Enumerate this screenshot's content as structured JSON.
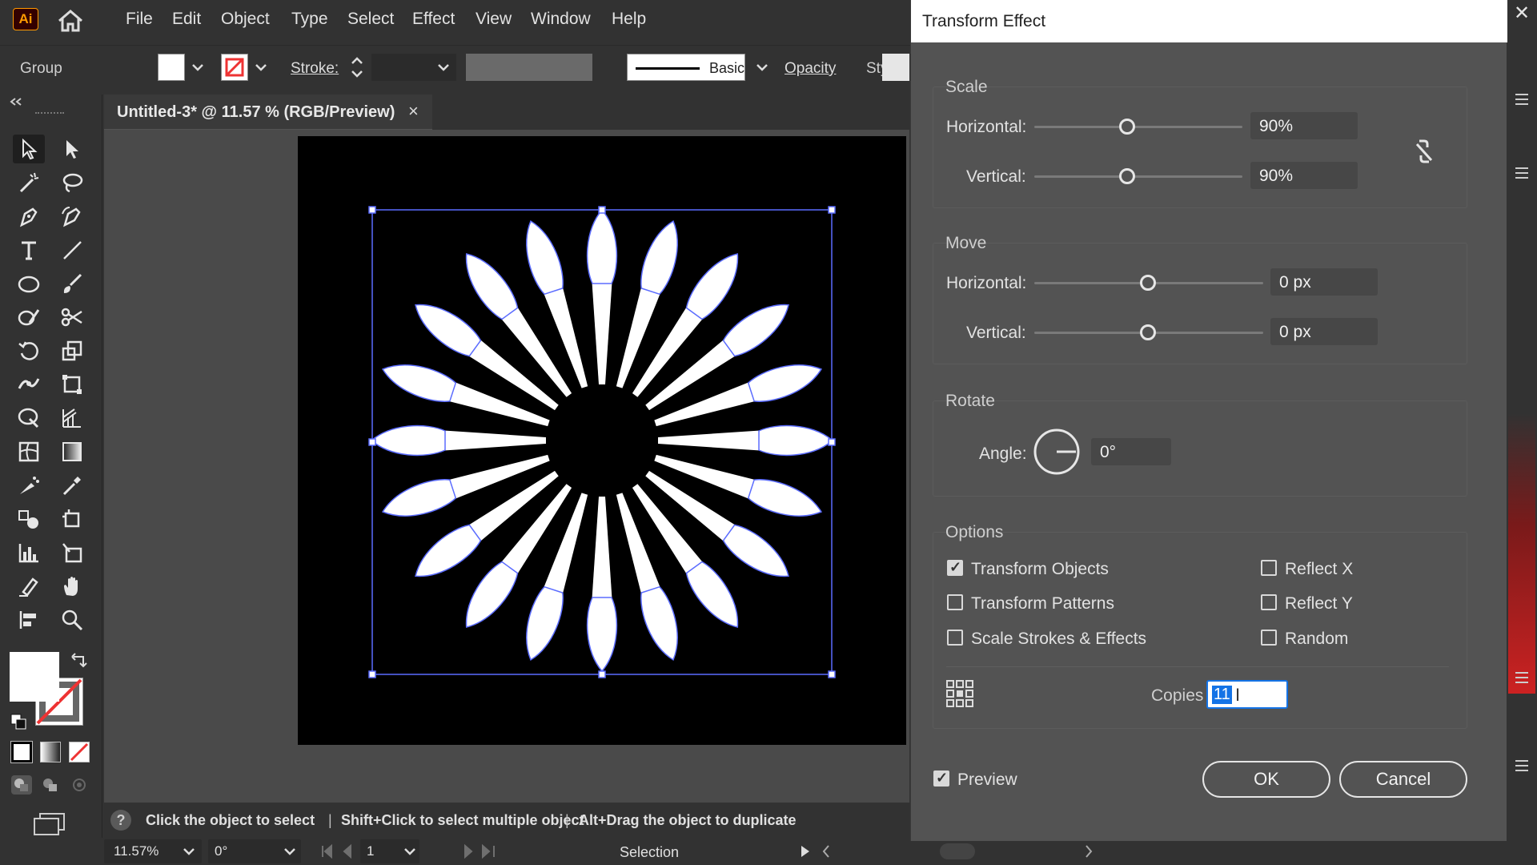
{
  "app": {
    "logo": "Ai"
  },
  "menu": [
    "File",
    "Edit",
    "Object",
    "Type",
    "Select",
    "Effect",
    "View",
    "Window",
    "Help"
  ],
  "control": {
    "selection_type": "Group",
    "stroke_label": "Stroke:",
    "brush_label": "Basic",
    "opacity_label": "Opacity",
    "style_label": "Style:"
  },
  "document": {
    "tab_title": "Untitled-3* @ 11.57 % (RGB/Preview)",
    "close": "×"
  },
  "status": {
    "hint_1": "Click the object to select",
    "sep": "|",
    "hint_2": "Shift+Click to select multiple object",
    "hint_3": "Alt+Drag the object to duplicate",
    "zoom": "11.57%",
    "rotation": "0°",
    "artboard_num": "1",
    "tool_name": "Selection"
  },
  "dialog": {
    "title": "Transform Effect",
    "close": "✕",
    "scale": {
      "label": "Scale",
      "horizontal_label": "Horizontal:",
      "horizontal_value": "90%",
      "vertical_label": "Vertical:",
      "vertical_value": "90%"
    },
    "move": {
      "label": "Move",
      "horizontal_label": "Horizontal:",
      "horizontal_value": "0 px",
      "vertical_label": "Vertical:",
      "vertical_value": "0 px"
    },
    "rotate": {
      "label": "Rotate",
      "angle_label": "Angle:",
      "angle_value": "0°"
    },
    "options": {
      "label": "Options",
      "transform_objects": "Transform Objects",
      "transform_patterns": "Transform Patterns",
      "scale_strokes": "Scale Strokes & Effects",
      "reflect_x": "Reflect X",
      "reflect_y": "Reflect Y",
      "random": "Random",
      "transform_objects_checked": true,
      "transform_patterns_checked": false,
      "scale_strokes_checked": false,
      "reflect_x_checked": false,
      "reflect_y_checked": false,
      "random_checked": false
    },
    "copies_label": "Copies",
    "copies_value": "11",
    "preview_label": "Preview",
    "preview_checked": true,
    "ok_label": "OK",
    "cancel_label": "Cancel"
  },
  "colors": {
    "accent": "#1473e6",
    "selection": "#5b6cff",
    "logo": "#ff9a00"
  }
}
